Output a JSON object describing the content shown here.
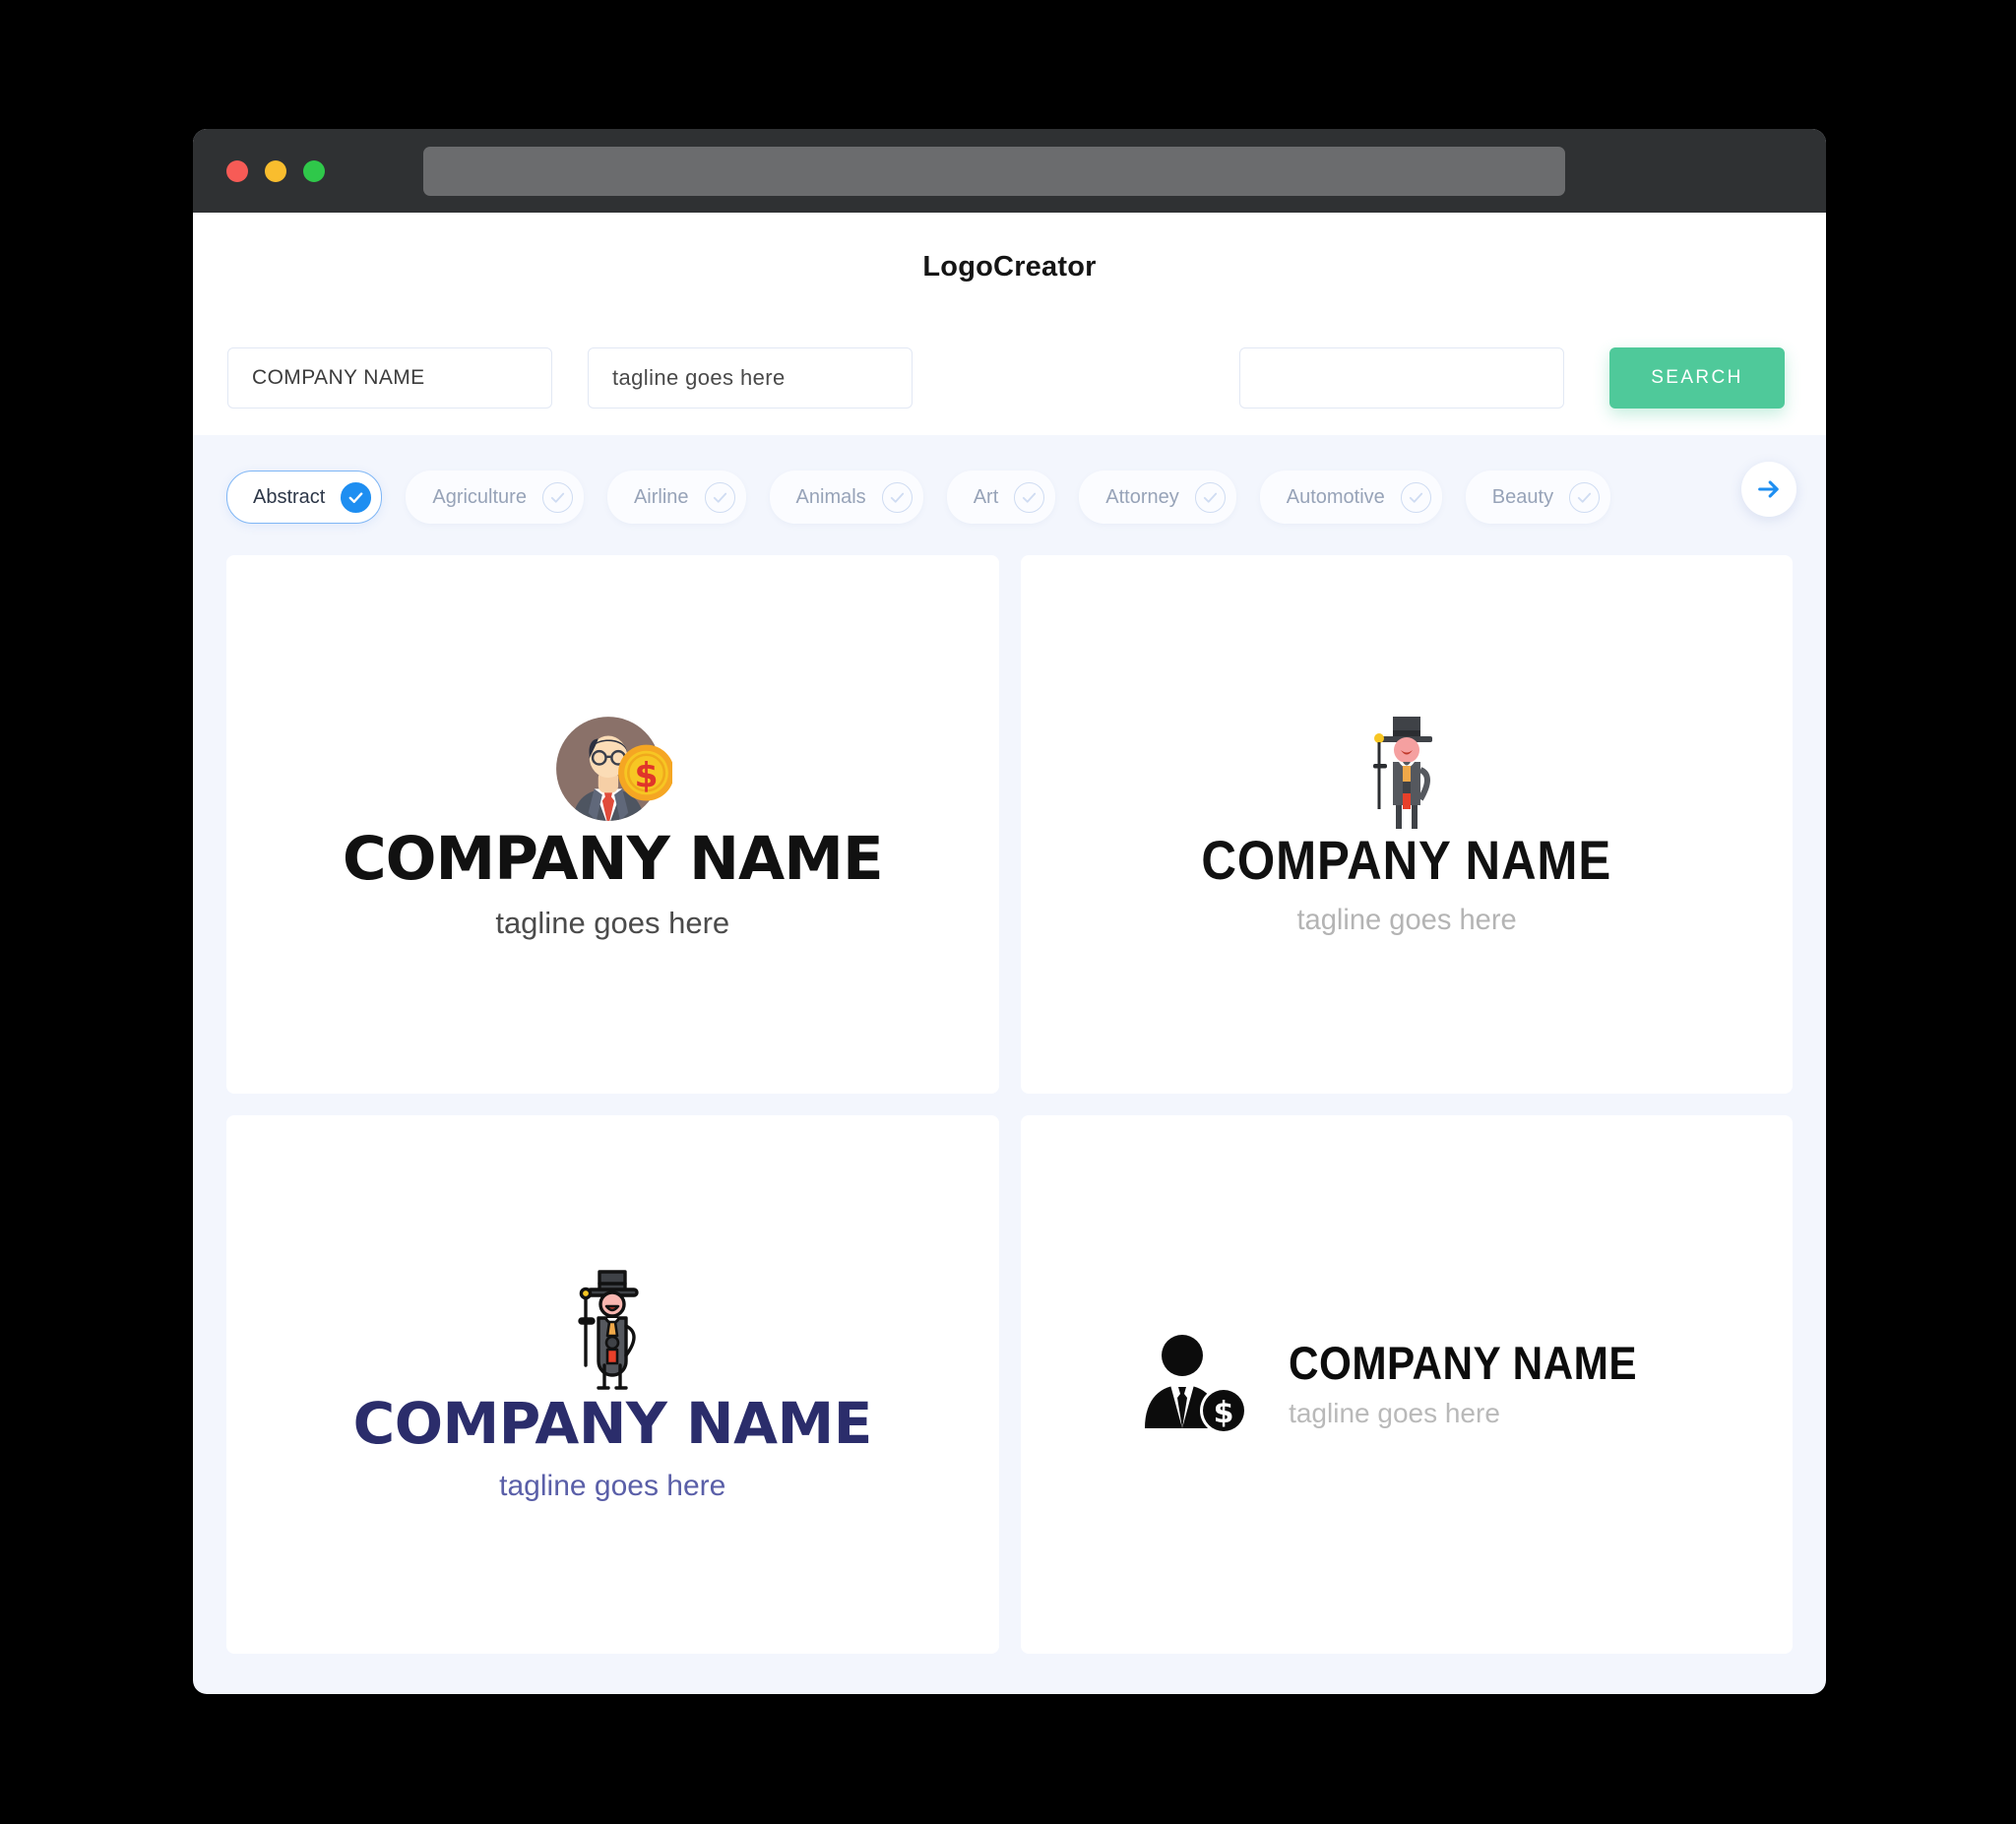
{
  "window": {
    "traffic_lights": [
      "close",
      "minimize",
      "maximize"
    ],
    "url_value": ""
  },
  "header": {
    "app_title": "LogoCreator"
  },
  "search": {
    "company_value": "COMPANY NAME",
    "company_placeholder": "COMPANY NAME",
    "tagline_value": "tagline goes here",
    "tagline_placeholder": "tagline goes here",
    "extra_value": "",
    "extra_placeholder": "",
    "search_label": "SEARCH",
    "search_button_color": "#4fc99a"
  },
  "categories": {
    "accent_color": "#1e8ef1",
    "next_arrow_icon": "arrow-right-icon",
    "items": [
      {
        "label": "Abstract",
        "selected": true
      },
      {
        "label": "Agriculture",
        "selected": false
      },
      {
        "label": "Airline",
        "selected": false
      },
      {
        "label": "Animals",
        "selected": false
      },
      {
        "label": "Art",
        "selected": false
      },
      {
        "label": "Attorney",
        "selected": false
      },
      {
        "label": "Automotive",
        "selected": false
      },
      {
        "label": "Beauty",
        "selected": false
      }
    ]
  },
  "results": [
    {
      "id": "logo-1",
      "icon": "businessman-coin-circle-icon",
      "layout": "vertical",
      "name": "COMPANY NAME",
      "tagline": "tagline goes here",
      "name_color": "#111111",
      "tagline_color": "#4b4b4b"
    },
    {
      "id": "logo-2",
      "icon": "gentleman-tophat-cane-icon",
      "layout": "vertical",
      "name": "COMPANY NAME",
      "tagline": "tagline goes here",
      "name_color": "#111111",
      "tagline_color": "#b4b4b4"
    },
    {
      "id": "logo-3",
      "icon": "gentleman-tophat-cane-outline-icon",
      "layout": "vertical",
      "name": "COMPANY NAME",
      "tagline": "tagline goes here",
      "name_color": "#2b2d6b",
      "tagline_color": "#5a5fa8"
    },
    {
      "id": "logo-4",
      "icon": "businessman-dollar-silhouette-icon",
      "layout": "horizontal",
      "name": "COMPANY NAME",
      "tagline": "tagline goes here",
      "name_color": "#0c0c0c",
      "tagline_color": "#b9b9b9"
    }
  ]
}
